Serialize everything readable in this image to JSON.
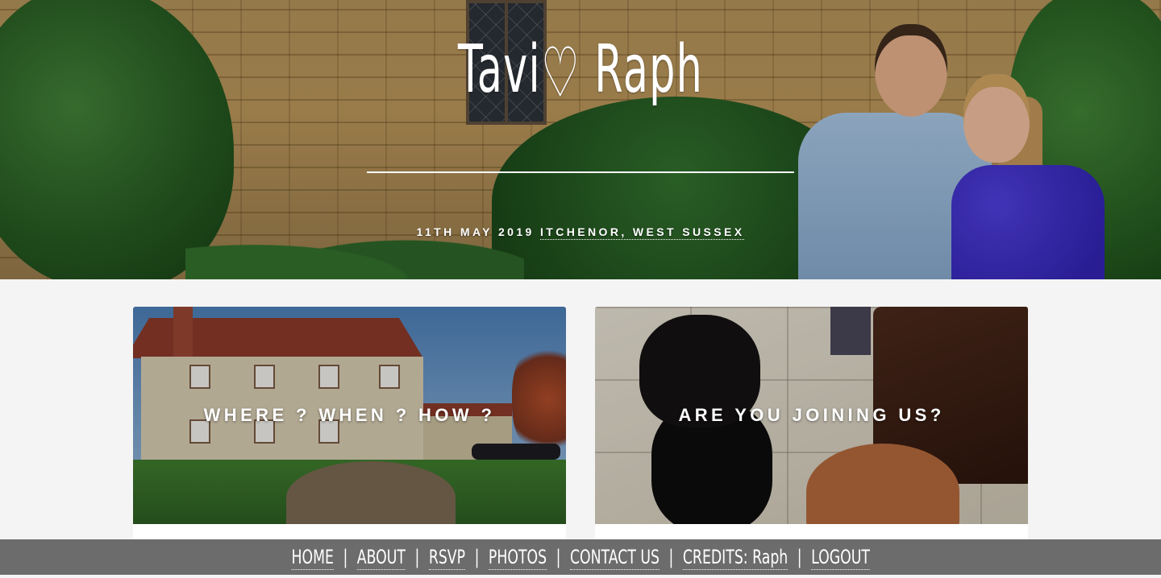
{
  "hero": {
    "title_left": "Tavi",
    "heart": "♡",
    "title_right": "Raph",
    "date": "11TH MAY 2019",
    "location": "ITCHENOR, WEST SUSSEX"
  },
  "cards": [
    {
      "label": "WHERE ? WHEN ? HOW ?"
    },
    {
      "label": "ARE YOU JOINING US?"
    }
  ],
  "nav": {
    "separator": "|",
    "items": [
      {
        "label": "HOME"
      },
      {
        "label": "ABOUT"
      },
      {
        "label": "RSVP"
      },
      {
        "label": "PHOTOS"
      },
      {
        "label": "CONTACT US"
      },
      {
        "label": "CREDITS: Raph"
      },
      {
        "label": "LOGOUT"
      }
    ]
  }
}
